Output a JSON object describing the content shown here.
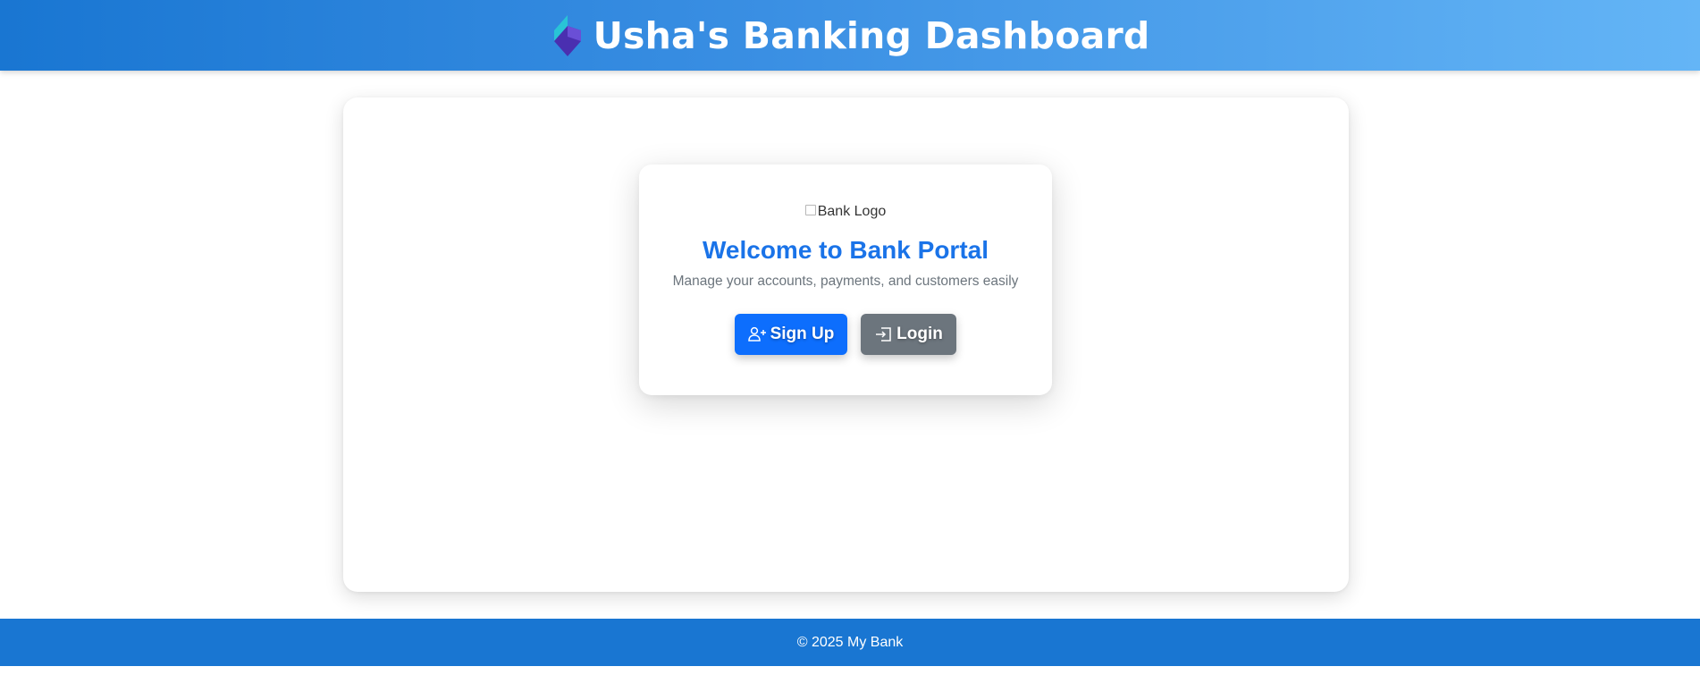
{
  "header": {
    "title": "Usha's Banking Dashboard",
    "icon": "brand-logo-icon"
  },
  "welcome_card": {
    "logo_alt": "Bank Logo",
    "title": "Welcome to Bank Portal",
    "subtitle": "Manage your accounts, payments, and customers easily",
    "buttons": {
      "signup": {
        "label": "Sign Up",
        "icon": "person-plus-icon"
      },
      "login": {
        "label": "Login",
        "icon": "box-arrow-in-right-icon"
      }
    }
  },
  "footer": {
    "text": "© 2025 My Bank"
  },
  "colors": {
    "header_gradient_start": "#1976d2",
    "header_gradient_end": "#64b5f6",
    "primary": "#0d6efd",
    "secondary": "#6c757d",
    "title_blue": "#1a73e8",
    "footer": "#1976d2"
  }
}
